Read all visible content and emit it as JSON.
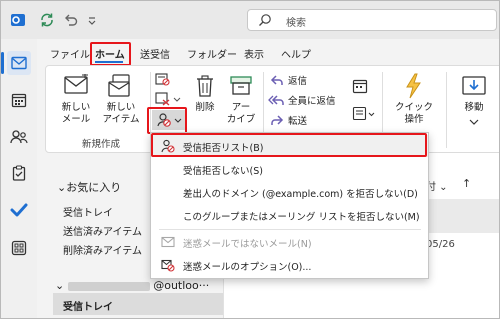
{
  "titlebar": {
    "search_placeholder": "検索"
  },
  "tabs": [
    {
      "label": "ファイル"
    },
    {
      "label": "ホーム"
    },
    {
      "label": "送受信"
    },
    {
      "label": "フォルダー"
    },
    {
      "label": "表示"
    },
    {
      "label": "ヘルプ"
    }
  ],
  "ribbon": {
    "new_mail_label": "新しい\nメール",
    "new_item_label": "新しい\nアイテム",
    "new_item_dropdown": "⌄",
    "new_group_title": "新規作成",
    "delete_label": "削除",
    "archive_label": "アー\nカイブ",
    "reply_label": "返信",
    "reply_all_label": "全員に返信",
    "forward_label": "転送",
    "quick_steps_label": "クイック\n操作",
    "move_label": "移動"
  },
  "folders": {
    "favorites_header": "お気に入り",
    "items": [
      "受信トレイ",
      "送信済みアイテム",
      "削除済みアイテム"
    ],
    "account_suffix": "@outloo···",
    "account_inbox": "受信トレイ"
  },
  "maillist": {
    "sort_label": "付 ⌄",
    "sort_arrow": "↑",
    "date": "05/26"
  },
  "menu": {
    "items": [
      {
        "label": "受信拒否リスト(B)",
        "enabled": true
      },
      {
        "label": "受信拒否しない(S)",
        "enabled": true
      },
      {
        "label": "差出人のドメイン (@example.com) を拒否しない(D)",
        "enabled": true
      },
      {
        "label": "このグループまたはメーリング リストを拒否しない(M)",
        "enabled": true
      },
      {
        "label": "迷惑メールではないメール(N)",
        "enabled": false
      },
      {
        "label": "迷惑メールのオプション(O)...",
        "enabled": true
      }
    ]
  },
  "colors": {
    "accent": "#1f6fd1",
    "highlight_box": "#e6161b",
    "refresh_green": "#2e8b57"
  }
}
